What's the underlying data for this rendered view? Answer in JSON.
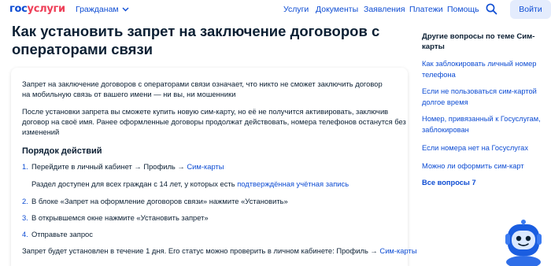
{
  "header": {
    "logo_part1": "гос",
    "logo_part2": "услуги",
    "citizens_label": "Гражданам",
    "nav": [
      "Услуги",
      "Документы",
      "Заявления",
      "Платежи",
      "Помощь"
    ],
    "login_label": "Войти"
  },
  "main": {
    "title": "Как установить запрет на заключение договоров с операторами связи",
    "intro_line1": "Запрет на заключение договоров с операторами связи означает, что никто не сможет заключить договор",
    "intro_line2": "на мобильную связь от вашего имени — ни вы, ни мошенники",
    "para_line1": "После установки запрета вы сможете купить новую сим-карту, но её не получится активировать, заключив",
    "para_line2": "договор на своё имя. Ранее оформленные договоры продолжат действовать, номера телефонов останутся без",
    "para_line3": "изменений",
    "steps_title": "Порядок действий",
    "steps": [
      {
        "num": "1.",
        "text": "Перейдите в личный кабинет → Профиль → ",
        "link": "Сим-карты"
      },
      {
        "num": "2.",
        "text": "В блоке «Запрет на оформление договоров связи» нажмите «Установить»"
      },
      {
        "num": "3.",
        "text": "В открывшемся окне нажмите «Установить запрет»"
      },
      {
        "num": "4.",
        "text": "Отправьте запрос"
      }
    ],
    "step1_note": "Раздел доступен для всех граждан с 14 лет, у которых есть ",
    "step1_note_link": "подтверждённая учётная запись",
    "footer_text": "Запрет будет установлен в течение 1 дня. Его статус можно проверить в личном кабинете: Профиль → ",
    "footer_link": "Сим-карты"
  },
  "sidebar": {
    "title": "Другие вопросы по теме Сим-карты",
    "links": [
      "Как заблокировать личный номер телефона",
      "Если не пользоваться сим-картой долгое время",
      "Номер, привязанный к Госуслугам, заблокирован",
      "Если номера нет на Госуслугах",
      "Можно ли оформить сим-карт"
    ],
    "all_label": "Все вопросы 7"
  },
  "colors": {
    "brand_blue": "#0d4cd3",
    "brand_red": "#ee3f58",
    "text": "#0b1f33",
    "button_bg": "#e4ecfd"
  },
  "icons": [
    "chevron-down-icon",
    "search-icon",
    "robot-assistant-icon"
  ]
}
